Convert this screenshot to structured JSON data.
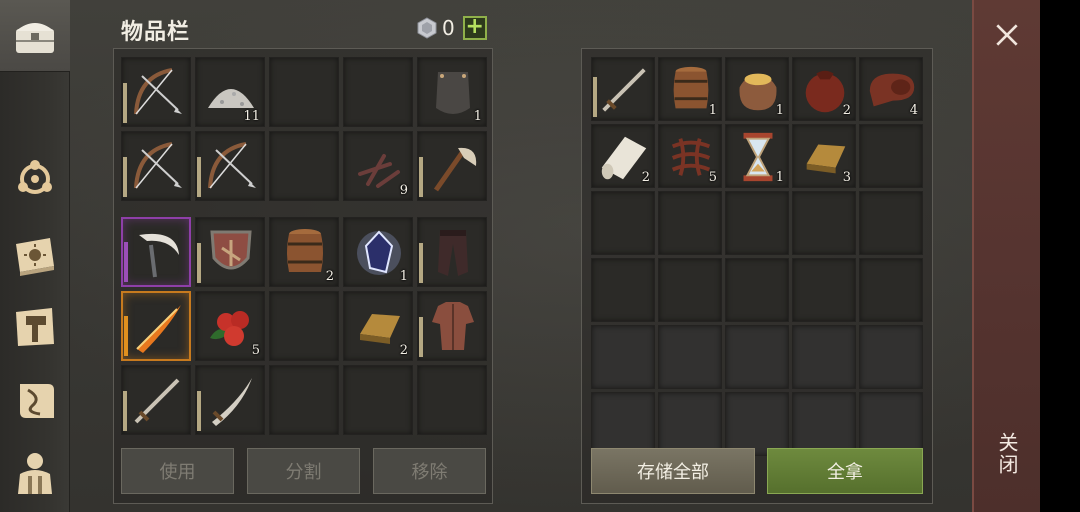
{
  "inventory": {
    "title": "物品栏",
    "currency_value": "0",
    "add_label": "+",
    "rows": [
      [
        {
          "icon": "bow-icon",
          "qty": "",
          "durability": true
        },
        {
          "icon": "stone-pile-icon",
          "qty": "11",
          "durability": false
        },
        {
          "icon": "",
          "qty": "",
          "durability": false
        },
        {
          "icon": "",
          "qty": "",
          "durability": false
        },
        {
          "icon": "iron-plate-icon",
          "qty": "1",
          "durability": false
        }
      ],
      [
        {
          "icon": "bow-icon",
          "qty": "",
          "durability": true
        },
        {
          "icon": "bow-icon",
          "qty": "",
          "durability": true
        },
        {
          "icon": "",
          "qty": "",
          "durability": false
        },
        {
          "icon": "nails-icon",
          "qty": "9",
          "durability": false
        },
        {
          "icon": "axe-icon",
          "qty": "",
          "durability": true
        }
      ],
      [
        {
          "icon": "scythe-icon",
          "qty": "",
          "durability": true,
          "rarity": "purple"
        },
        {
          "icon": "shield-icon",
          "qty": "",
          "durability": true
        },
        {
          "icon": "barrel-icon",
          "qty": "2",
          "durability": false
        },
        {
          "icon": "crystal-icon",
          "qty": "1",
          "durability": false
        },
        {
          "icon": "pants-icon",
          "qty": "",
          "durability": true
        }
      ],
      [
        {
          "icon": "flame-sword-icon",
          "qty": "",
          "durability": true,
          "rarity": "orange"
        },
        {
          "icon": "berries-icon",
          "qty": "5",
          "durability": false
        },
        {
          "icon": "",
          "qty": "",
          "durability": false
        },
        {
          "icon": "gold-bar-icon",
          "qty": "2",
          "durability": false
        },
        {
          "icon": "armor-icon",
          "qty": "",
          "durability": true
        }
      ],
      [
        {
          "icon": "sword-icon",
          "qty": "",
          "durability": true
        },
        {
          "icon": "sabre-icon",
          "qty": "",
          "durability": true
        },
        {
          "icon": "",
          "qty": "",
          "durability": false
        },
        {
          "icon": "",
          "qty": "",
          "durability": false
        },
        {
          "icon": "",
          "qty": "",
          "durability": false
        }
      ]
    ],
    "buttons": {
      "use": "使用",
      "split": "分割",
      "remove": "移除"
    }
  },
  "container": {
    "rows": [
      [
        {
          "icon": "sword-icon",
          "qty": "",
          "durability": true
        },
        {
          "icon": "barrel-icon",
          "qty": "1",
          "durability": false
        },
        {
          "icon": "grain-sack-icon",
          "qty": "1",
          "durability": false
        },
        {
          "icon": "leather-sack-icon",
          "qty": "2",
          "durability": false
        },
        {
          "icon": "leather-roll-icon",
          "qty": "4",
          "durability": false
        }
      ],
      [
        {
          "icon": "cloth-roll-icon",
          "qty": "2",
          "durability": false
        },
        {
          "icon": "rope-icon",
          "qty": "5",
          "durability": false
        },
        {
          "icon": "hourglass-icon",
          "qty": "1",
          "durability": false
        },
        {
          "icon": "gold-bar-icon",
          "qty": "3",
          "durability": false
        },
        {
          "icon": "",
          "qty": "",
          "durability": false
        }
      ],
      [
        {
          "icon": "",
          "qty": "",
          "durability": false
        },
        {
          "icon": "",
          "qty": "",
          "durability": false
        },
        {
          "icon": "",
          "qty": "",
          "durability": false
        },
        {
          "icon": "",
          "qty": "",
          "durability": false
        },
        {
          "icon": "",
          "qty": "",
          "durability": false
        }
      ],
      [
        {
          "icon": "",
          "qty": "",
          "durability": false
        },
        {
          "icon": "",
          "qty": "",
          "durability": false
        },
        {
          "icon": "",
          "qty": "",
          "durability": false
        },
        {
          "icon": "",
          "qty": "",
          "durability": false
        },
        {
          "icon": "",
          "qty": "",
          "durability": false
        }
      ],
      [
        {
          "icon": "",
          "qty": "",
          "durability": false
        },
        {
          "icon": "",
          "qty": "",
          "durability": false
        },
        {
          "icon": "",
          "qty": "",
          "durability": false
        },
        {
          "icon": "",
          "qty": "",
          "durability": false
        },
        {
          "icon": "",
          "qty": "",
          "durability": false
        }
      ],
      [
        {
          "icon": "",
          "qty": "",
          "durability": false
        },
        {
          "icon": "",
          "qty": "",
          "durability": false
        },
        {
          "icon": "",
          "qty": "",
          "durability": false
        },
        {
          "icon": "",
          "qty": "",
          "durability": false
        },
        {
          "icon": "",
          "qty": "",
          "durability": false
        }
      ]
    ],
    "buttons": {
      "store_all": "存储全部",
      "take_all": "全拿"
    }
  },
  "sidebar": {
    "items": [
      "chest-icon",
      "crafting-icon",
      "skills-book-icon",
      "build-hammer-icon",
      "quest-scroll-icon",
      "character-icon"
    ]
  },
  "close": {
    "label": "关闭"
  },
  "colors": {
    "rarity_purple": "#8e3fa8",
    "rarity_orange": "#c77a1e",
    "take_all_green": "#6e8a3e",
    "close_panel": "#5f3a34"
  }
}
